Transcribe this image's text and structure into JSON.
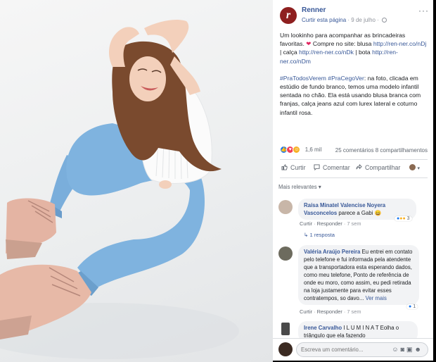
{
  "page": {
    "name": "Renner",
    "follow": "Curtir esta página",
    "date": "9 de julho",
    "logo_letter": "r"
  },
  "post": {
    "text1": "Um lookinho para acompanhar as brincadeiras favoritas.",
    "heart": "❤",
    "text1b": "Compre no site: blusa",
    "link1": "http://ren-ner.co/nDj",
    "sep1": "| calça",
    "link2": "http://ren-ner.co/nDk",
    "sep2": "| bota",
    "link3": "http://ren-ner.co/nDm",
    "hashtags": "#PraTodosVerem #PraCegoVer",
    "text2": ": na foto, clicada em estúdio de fundo branco, temos uma modelo infantil sentada no chão. Ela está usando blusa branca com franjas, calça jeans azul com lurex lateral e coturno infantil rosa."
  },
  "reactions": {
    "count": "1,6 mil",
    "comments": "25 comentários",
    "shares": "8 compartilhamentos"
  },
  "actions": {
    "like": "Curtir",
    "comment": "Comentar",
    "share": "Compartilhar"
  },
  "sort": "Mais relevantes ▾",
  "comments": [
    {
      "author": "Raísa Minatel Valencise Noyera Vasconcelos",
      "text": "parece a Gabi 😄",
      "like": "Curtir",
      "reply": "Responder",
      "time": "7 sem",
      "replies": "1 resposta",
      "reaction_count": "3"
    },
    {
      "author": "Valéria Araújo Pereira",
      "text": "Eu entrei em contato pelo telefone e fui informada pela atendente que a transportadora esta esperando dados, como meu telefone, Ponto de referência de onde eu moro, como assim, eu pedi retirada na loja justamente para evitar esses contratempos, so davo...",
      "see_more": "Ver mais",
      "like": "Curtir",
      "reply": "Responder",
      "time": "7 sem",
      "reaction_count": "1"
    },
    {
      "author": "Irene Carvalho",
      "text": "I L U M I N A T Eolha o triângulo que ela fazendo",
      "like": "",
      "reply": "",
      "time": ""
    }
  ],
  "composer": {
    "placeholder": "Escreva um comentário..."
  },
  "colors": {
    "link": "#385898",
    "brand": "#8e1f1f",
    "like_blue": "#1877f2",
    "heart": "#e0245e"
  }
}
